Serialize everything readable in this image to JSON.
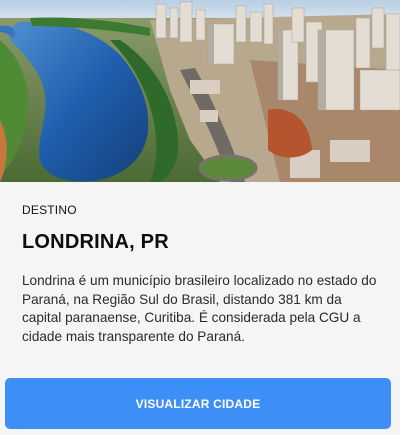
{
  "card": {
    "image": {
      "subject": "aerial-city-lake-photo",
      "colors": {
        "sky": "#c9d9e8",
        "water": "#1f5fae",
        "vegetation": "#3f7d36",
        "buildings": "#d9d2c6"
      }
    },
    "eyebrow": "DESTINO",
    "title": "LONDRINA, PR",
    "description": "Londrina é um município brasileiro localizado no estado do Paraná, na Região Sul do Brasil, distando 381 km da capital paranaense, Curitiba. É considerada pela CGU a cidade mais transparente do Paraná.",
    "button_label": "VISUALIZAR CIDADE",
    "accent_color": "#3d8ff7"
  }
}
